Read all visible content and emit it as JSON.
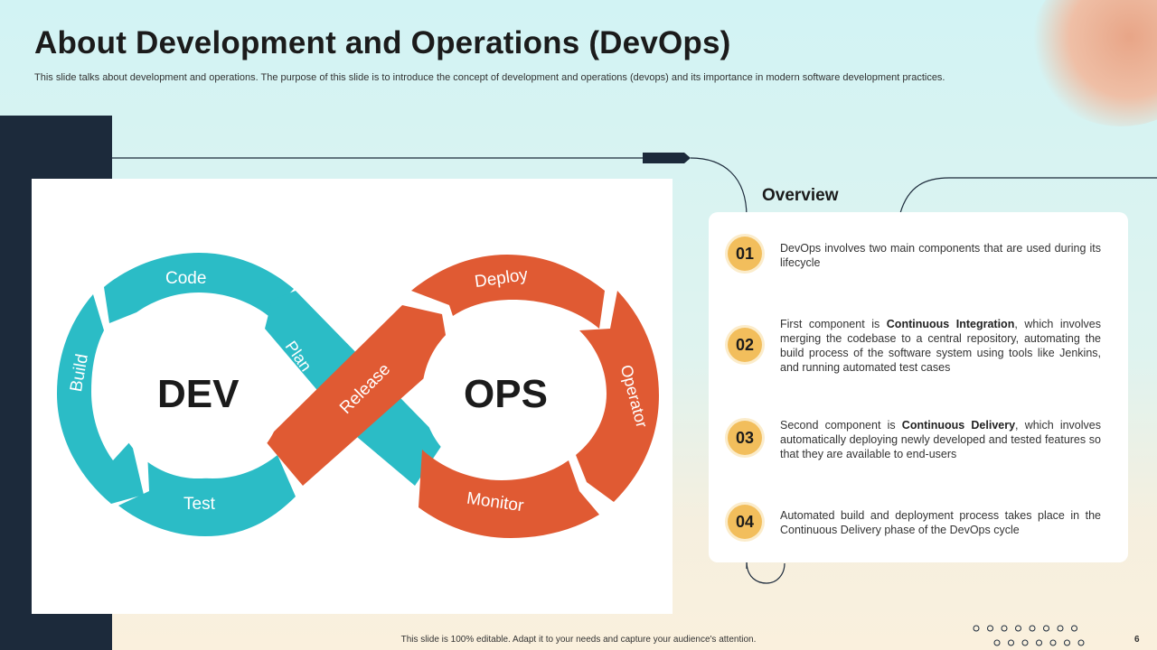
{
  "title": "About Development and Operations (DevOps)",
  "subtitle": "This slide talks about development and operations. The purpose of this slide is to introduce the concept of development and operations (devops) and its importance in modern software development practices.",
  "diagram": {
    "dev_label": "DEV",
    "ops_label": "OPS",
    "segments": {
      "code": "Code",
      "build": "Build",
      "test": "Test",
      "plan": "Plan",
      "release": "Release",
      "deploy": "Deploy",
      "operator": "Operator",
      "monitor": "Monitor"
    },
    "colors": {
      "dev": "#2bbcc6",
      "ops": "#e05a33",
      "center_text": "#1b1b1b"
    }
  },
  "overview": {
    "heading": "Overview",
    "items": [
      {
        "number": "01",
        "text_before": "DevOps involves two main components that are used during its lifecycle",
        "bold": "",
        "text_after": ""
      },
      {
        "number": "02",
        "text_before": "First component is ",
        "bold": "Continuous Integration",
        "text_after": ", which involves merging the codebase to a central repository, automating the build process of the software system using tools like Jenkins, and running automated test cases"
      },
      {
        "number": "03",
        "text_before": "Second component is ",
        "bold": "Continuous Delivery",
        "text_after": ", which involves automatically deploying newly developed and tested features so that they are available to end-users"
      },
      {
        "number": "04",
        "text_before": "Automated build and deployment process takes place in the Continuous Delivery phase of the DevOps cycle",
        "bold": "",
        "text_after": ""
      }
    ],
    "badge_color": "#f2be5c"
  },
  "footer": {
    "note": "This slide is 100% editable. Adapt it to your needs and capture your audience's attention.",
    "page_number": "6"
  },
  "theme": {
    "dark_panel": "#1c2a3b",
    "background_top": "#d2f3f4",
    "background_bottom": "#faf0dd"
  }
}
